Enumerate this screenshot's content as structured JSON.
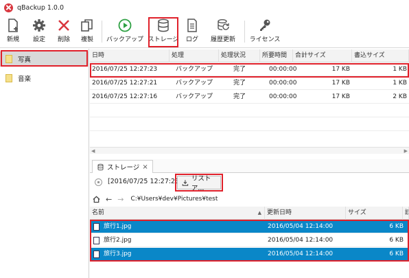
{
  "window": {
    "title": "qBackup 1.0.0"
  },
  "toolbar": {
    "new_label": "新規",
    "settings_label": "設定",
    "delete_label": "削除",
    "duplicate_label": "複製",
    "backup_label": "バックアップ",
    "storage_label": "ストレージ",
    "log_label": "ログ",
    "history_label": "履歴更新",
    "license_label": "ライセンス"
  },
  "sidebar": {
    "items": [
      {
        "label": "写真"
      },
      {
        "label": "音楽"
      }
    ]
  },
  "jobs": {
    "columns": [
      "日時",
      "処理",
      "処理状況",
      "所要時間",
      "合計サイズ",
      "書込サイズ"
    ],
    "rows": [
      {
        "datetime": "2016/07/25 12:27:23",
        "process": "バックアップ",
        "status": "完了",
        "duration": "00:00:00",
        "total": "17 KB",
        "written": "1 KB"
      },
      {
        "datetime": "2016/07/25 12:27:21",
        "process": "バックアップ",
        "status": "完了",
        "duration": "00:00:00",
        "total": "17 KB",
        "written": "1 KB"
      },
      {
        "datetime": "2016/07/25 12:27:16",
        "process": "バックアップ",
        "status": "完了",
        "duration": "00:00:00",
        "total": "17 KB",
        "written": "2 KB"
      }
    ]
  },
  "storage_tab": {
    "label": "ストレージ",
    "close": "×"
  },
  "restore": {
    "snapshot": "[2016/07/25 12:27:23]",
    "button_label": "リストア..."
  },
  "path": {
    "value": "C:¥Users¥dev¥Pictures¥test"
  },
  "files": {
    "columns": [
      "名前",
      "更新日時",
      "サイズ",
      "読"
    ],
    "rows": [
      {
        "name": "旅行1.jpg",
        "modified": "2016/05/04 12:14:00",
        "size": "6 KB",
        "selected": true
      },
      {
        "name": "旅行2.jpg",
        "modified": "2016/05/04 12:14:00",
        "size": "6 KB",
        "selected": false
      },
      {
        "name": "旅行3.jpg",
        "modified": "2016/05/04 12:14:00",
        "size": "6 KB",
        "selected": true
      }
    ]
  },
  "colors": {
    "selection": "#0a87c8",
    "highlight": "#e0202a",
    "accent_green": "#2ea043"
  }
}
